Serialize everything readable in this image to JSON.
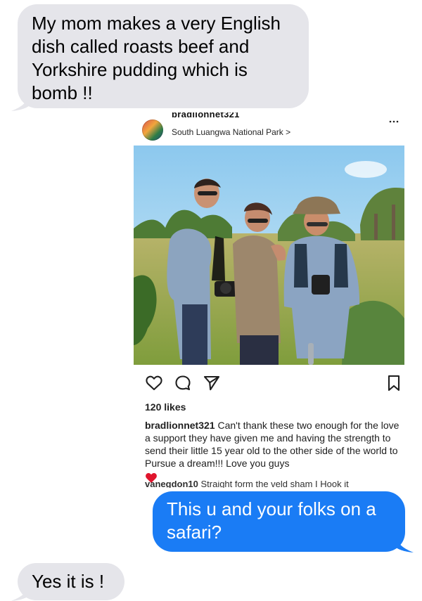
{
  "messages": {
    "incoming_top": "My mom makes a very English dish called roasts beef and Yorkshire pudding which is bomb !!",
    "outgoing": "This u and your folks on a safari?",
    "incoming_bottom": "Yes it is !"
  },
  "post": {
    "username": "bradlionnet321",
    "location": "South Luangwa National Park >",
    "likes": "120 likes",
    "caption_user": "bradlionnet321",
    "caption_text": " Can't thank these two enough for the love a support they have given me and having the strength to send their little 15 year old to the other side of the world to Pursue a dream!!! Love you guys",
    "comment_user": "vanegdon10",
    "comment_text": " Straight form the veld sham I Hook it"
  },
  "colors": {
    "incoming_bubble": "#e5e5ea",
    "outgoing_bubble": "#1a7cf5",
    "heart": "#e0152d"
  },
  "icons": {
    "post_actions": [
      "heart-outline-icon",
      "comment-icon",
      "paper-plane-icon",
      "bookmark-icon"
    ],
    "menu": "more-icon",
    "emoji": "red-heart-icon"
  }
}
